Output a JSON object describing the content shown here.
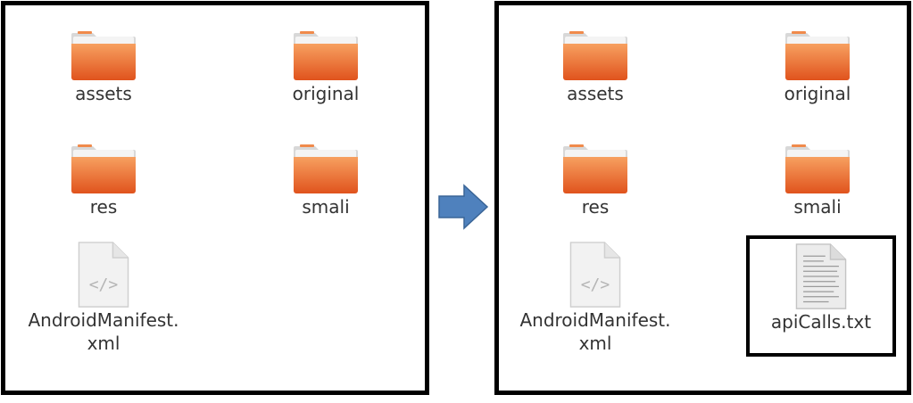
{
  "before": {
    "items": [
      {
        "name": "assets",
        "type": "folder"
      },
      {
        "name": "original",
        "type": "folder"
      },
      {
        "name": "res",
        "type": "folder"
      },
      {
        "name": "smali",
        "type": "folder"
      },
      {
        "name_line1": "AndroidManifest.",
        "name_line2": "xml",
        "type": "xml-file",
        "glyph": "</>"
      }
    ]
  },
  "after": {
    "items": [
      {
        "name": "assets",
        "type": "folder"
      },
      {
        "name": "original",
        "type": "folder"
      },
      {
        "name": "res",
        "type": "folder"
      },
      {
        "name": "smali",
        "type": "folder"
      },
      {
        "name_line1": "AndroidManifest.",
        "name_line2": "xml",
        "type": "xml-file",
        "glyph": "</>"
      },
      {
        "name": "apiCalls.txt",
        "type": "text-file",
        "highlighted": true
      }
    ]
  },
  "colors": {
    "folder_body": "#e8632a",
    "folder_top": "#f5a86e",
    "arrow": "#4f81bd",
    "border": "#000000"
  }
}
